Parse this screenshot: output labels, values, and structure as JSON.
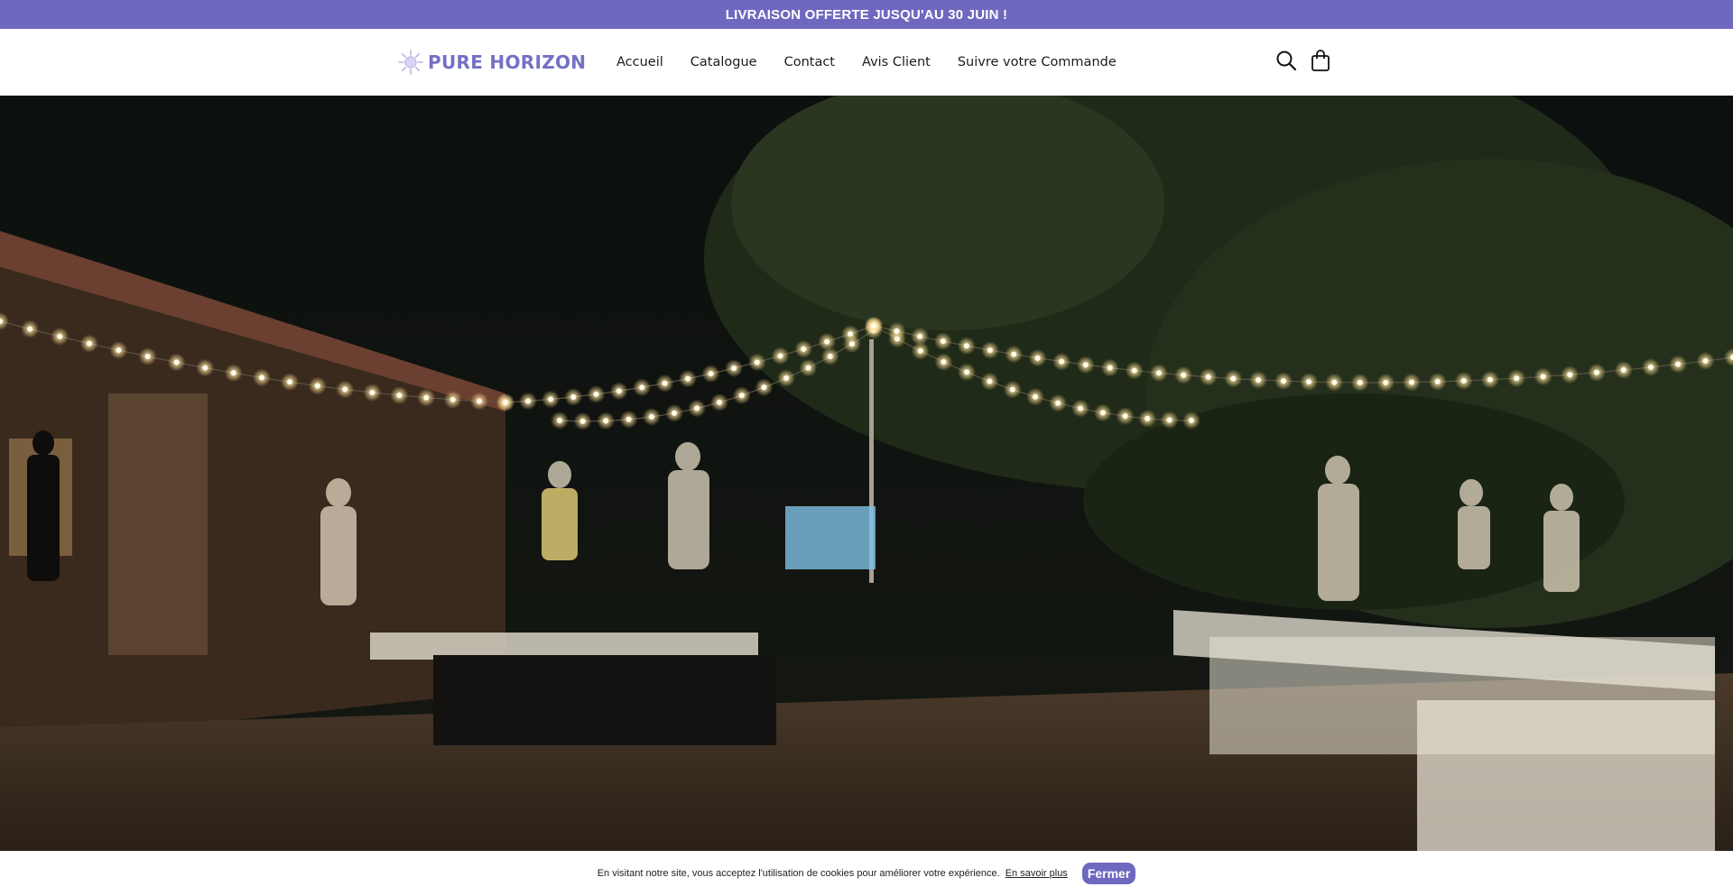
{
  "announcement": {
    "text": "LIVRAISON OFFERTE JUSQU'AU 30 JUIN !"
  },
  "header": {
    "logo_text": "PURE HORIZON",
    "nav": [
      {
        "label": "Accueil"
      },
      {
        "label": "Catalogue"
      },
      {
        "label": "Contact"
      },
      {
        "label": "Avis Client"
      },
      {
        "label": "Suivre votre Commande"
      }
    ],
    "icons": [
      "search-icon",
      "cart-icon"
    ]
  },
  "hero": {
    "image": "night-outdoor-event-string-lights"
  },
  "cookie": {
    "text": "En visitant notre site, vous acceptez l'utilisation de cookies pour améliorer votre expérience.",
    "link_label": "En savoir plus",
    "close_label": "Fermer"
  },
  "colors": {
    "accent": "#6f68bf",
    "logo": "#7470c4"
  }
}
